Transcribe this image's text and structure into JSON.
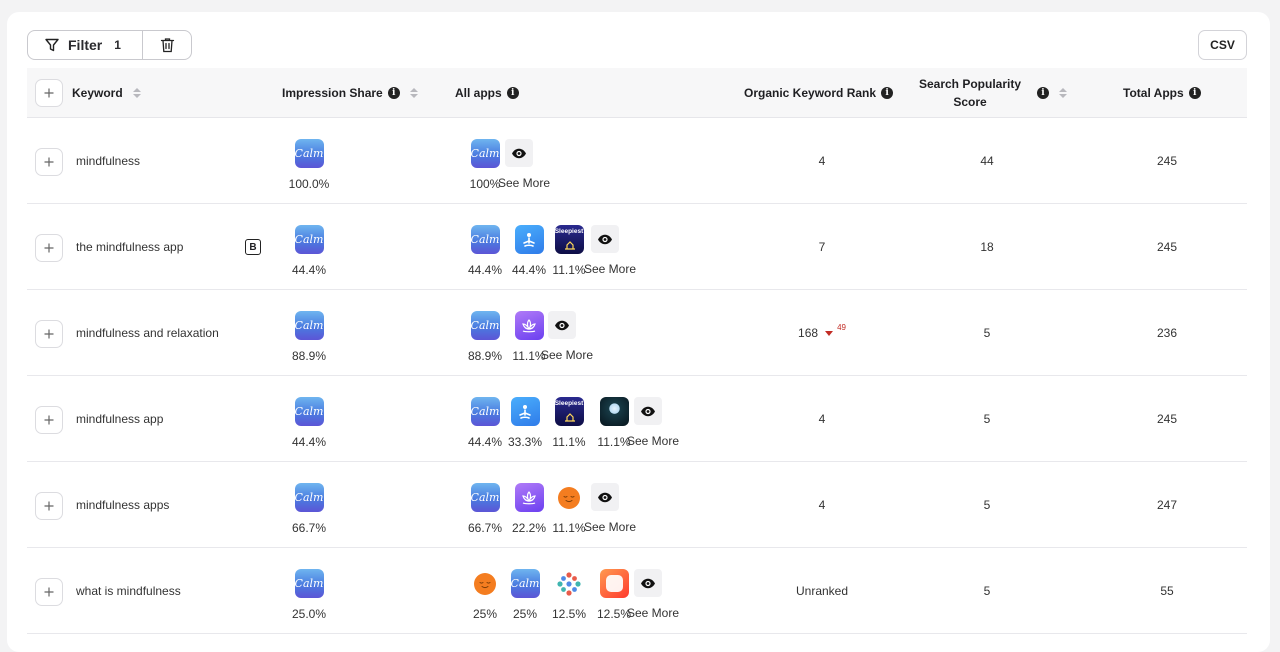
{
  "toolbar": {
    "filter_label": "Filter",
    "filter_count": "1",
    "csv_label": "CSV"
  },
  "columns": {
    "keyword": "Keyword",
    "impression_share": "Impression Share",
    "all_apps": "All apps",
    "organic_rank": "Organic Keyword Rank",
    "search_popularity_line1": "Search Popularity",
    "search_popularity_line2": "Score",
    "total_apps": "Total Apps"
  },
  "see_more_label": "See More",
  "rows": [
    {
      "keyword": "mindfulness",
      "badge": "",
      "impression_share": "100.0%",
      "apps": [
        {
          "icon": "calm-app-icon",
          "pct": "100%"
        }
      ],
      "rank": "4",
      "rank_delta": "",
      "popularity": "44",
      "total_apps": "245"
    },
    {
      "keyword": "the mindfulness app",
      "badge": "B",
      "impression_share": "44.4%",
      "apps": [
        {
          "icon": "calm-app-icon",
          "pct": "44.4%"
        },
        {
          "icon": "meditate-app-icon",
          "pct": "44.4%"
        },
        {
          "icon": "sleepiest-app-icon",
          "pct": "11.1%"
        }
      ],
      "rank": "7",
      "rank_delta": "",
      "popularity": "18",
      "total_apps": "245"
    },
    {
      "keyword": "mindfulness and relaxation",
      "badge": "",
      "impression_share": "88.9%",
      "apps": [
        {
          "icon": "calm-app-icon",
          "pct": "88.9%"
        },
        {
          "icon": "lotus-app-icon",
          "pct": "11.1%"
        }
      ],
      "rank": "168",
      "rank_delta": "49",
      "popularity": "5",
      "total_apps": "236"
    },
    {
      "keyword": "mindfulness app",
      "badge": "",
      "impression_share": "44.4%",
      "apps": [
        {
          "icon": "calm-app-icon",
          "pct": "44.4%"
        },
        {
          "icon": "meditate-app-icon",
          "pct": "33.3%"
        },
        {
          "icon": "sleepiest-app-icon",
          "pct": "11.1%"
        },
        {
          "icon": "moon-app-icon",
          "pct": "11.1%"
        }
      ],
      "rank": "4",
      "rank_delta": "",
      "popularity": "5",
      "total_apps": "245"
    },
    {
      "keyword": "mindfulness apps",
      "badge": "",
      "impression_share": "66.7%",
      "apps": [
        {
          "icon": "calm-app-icon",
          "pct": "66.7%"
        },
        {
          "icon": "lotus-app-icon",
          "pct": "22.2%"
        },
        {
          "icon": "headspace-app-icon",
          "pct": "11.1%"
        }
      ],
      "rank": "4",
      "rank_delta": "",
      "popularity": "5",
      "total_apps": "247"
    },
    {
      "keyword": "what is mindfulness",
      "badge": "",
      "impression_share": "25.0%",
      "apps": [
        {
          "icon": "headspace-app-icon",
          "pct": "25%"
        },
        {
          "icon": "calm-app-icon",
          "pct": "25%"
        },
        {
          "icon": "dots-app-icon",
          "pct": "12.5%"
        },
        {
          "icon": "red-square-app-icon",
          "pct": "12.5%"
        }
      ],
      "rank": "Unranked",
      "rank_delta": "",
      "popularity": "5",
      "total_apps": "55"
    }
  ]
}
